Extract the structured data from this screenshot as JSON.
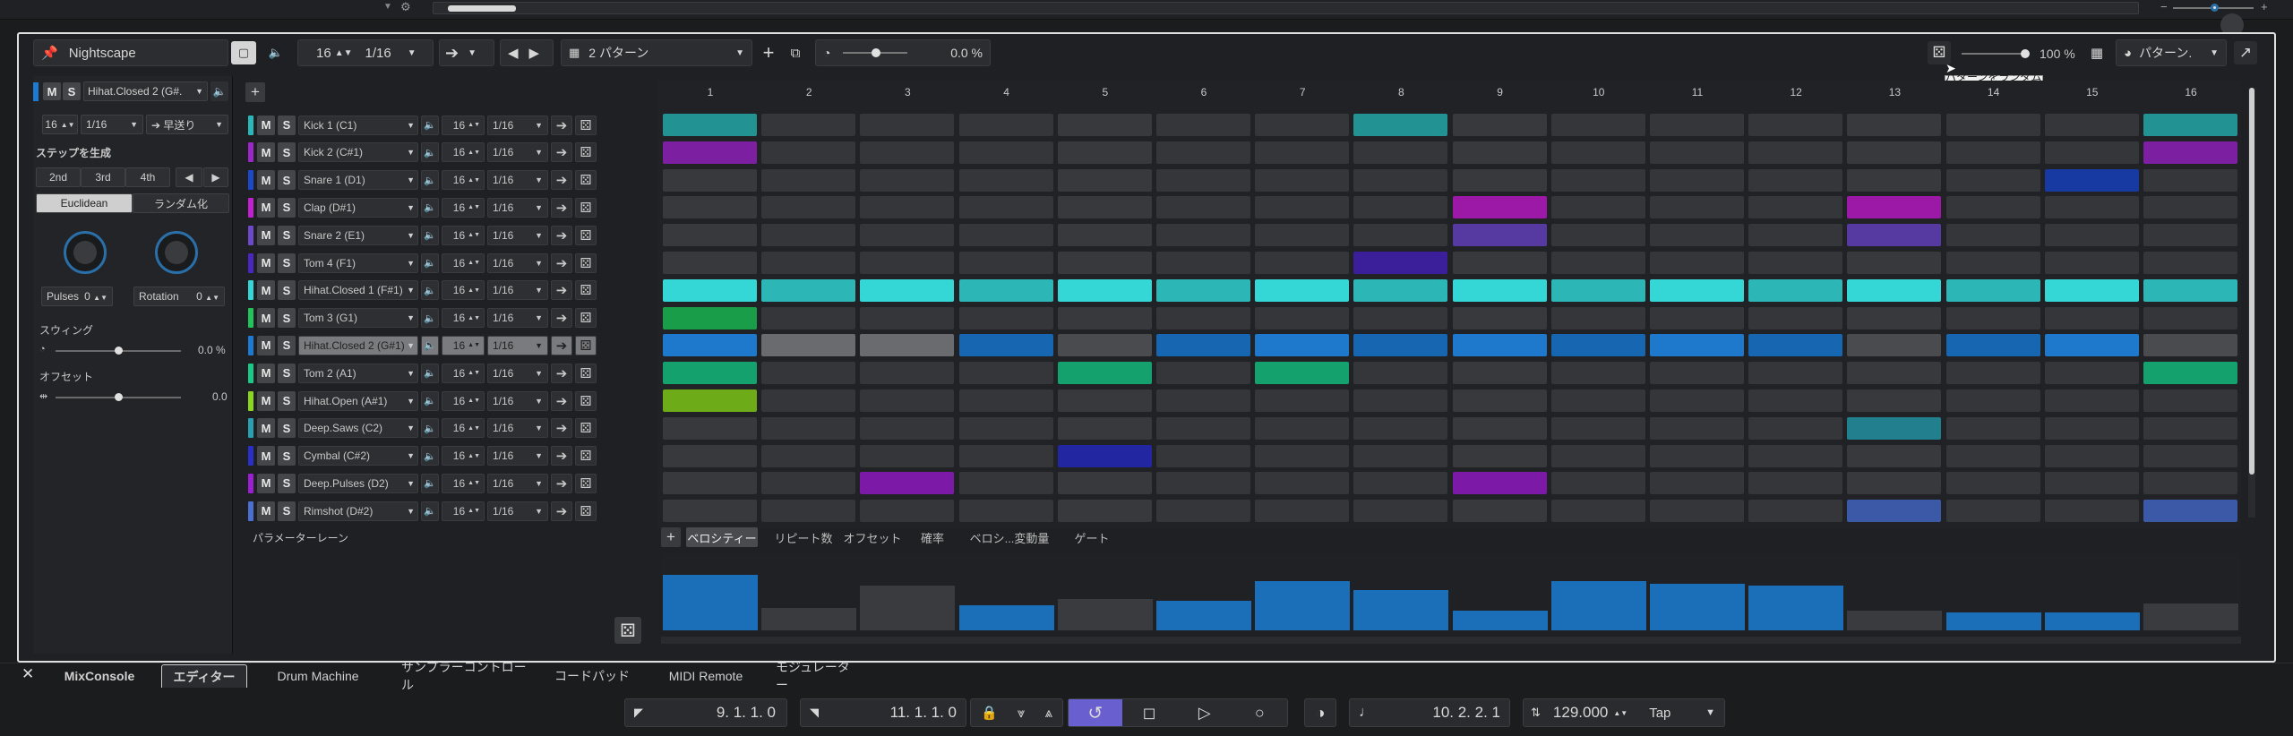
{
  "toolbar": {
    "title": "Nightscape",
    "quantize": "16",
    "resolution": "1/16",
    "pattern_name": "2 パターン",
    "swing_value": "0.0 %",
    "random_amount": "100 %",
    "pattern_menu": "パターン.",
    "tooltip": "パターンをランダム化"
  },
  "left": {
    "m": "M",
    "s": "S",
    "track_select": "Hihat.Closed 2 (G#.",
    "steps": "16",
    "res": "1/16",
    "direction": "早送り",
    "generate_label": "ステップを生成",
    "gen_2nd": "2nd",
    "gen_3rd": "3rd",
    "gen_4th": "4th",
    "euclidean": "Euclidean",
    "randomize": "ランダム化",
    "pulses_label": "Pulses",
    "pulses_value": "0",
    "rotation_label": "Rotation",
    "rotation_value": "0",
    "swing_label": "スウィング",
    "swing_value": "0.0 %",
    "offset_label": "オフセット",
    "offset_value": "0.0"
  },
  "tracks": [
    {
      "name": "Kick 1 (C1)",
      "color": "#2ab7b7",
      "steps": "16",
      "res": "1/16"
    },
    {
      "name": "Kick 2 (C#1)",
      "color": "#9b27c9",
      "steps": "16",
      "res": "1/16"
    },
    {
      "name": "Snare 1 (D1)",
      "color": "#1c49c9",
      "steps": "16",
      "res": "1/16"
    },
    {
      "name": "Clap (D#1)",
      "color": "#c21fcf",
      "steps": "16",
      "res": "1/16"
    },
    {
      "name": "Snare 2 (E1)",
      "color": "#6d49c9",
      "steps": "16",
      "res": "1/16"
    },
    {
      "name": "Tom 4 (F1)",
      "color": "#4a27c0",
      "steps": "16",
      "res": "1/16"
    },
    {
      "name": "Hihat.Closed 1 (F#1)",
      "color": "#35d6d6",
      "steps": "16",
      "res": "1/16"
    },
    {
      "name": "Tom 3 (G1)",
      "color": "#21c45a",
      "steps": "16",
      "res": "1/16"
    },
    {
      "name": "Hihat.Closed 2 (G#1)",
      "color": "#1e7ad0",
      "steps": "16",
      "res": "1/16"
    },
    {
      "name": "Tom 2 (A1)",
      "color": "#19c988",
      "steps": "16",
      "res": "1/16"
    },
    {
      "name": "Hihat.Open (A#1)",
      "color": "#8ad61f",
      "steps": "16",
      "res": "1/16"
    },
    {
      "name": "Deep.Saws (C2)",
      "color": "#2a9fb2",
      "steps": "16",
      "res": "1/16"
    },
    {
      "name": "Cymbal (C#2)",
      "color": "#2a2fc9",
      "steps": "16",
      "res": "1/16"
    },
    {
      "name": "Deep.Pulses (D2)",
      "color": "#9b1fd0",
      "steps": "16",
      "res": "1/16"
    },
    {
      "name": "Rimshot (D#2)",
      "color": "#4a6fd0",
      "steps": "16",
      "res": "1/16"
    }
  ],
  "columns": [
    "1",
    "2",
    "3",
    "4",
    "5",
    "6",
    "7",
    "8",
    "9",
    "10",
    "11",
    "12",
    "13",
    "14",
    "15",
    "16"
  ],
  "grid_on": [
    [
      1,
      0,
      0,
      0,
      0,
      0,
      0,
      1,
      0,
      0,
      0,
      0,
      0,
      0,
      0,
      1
    ],
    [
      1,
      0,
      0,
      0,
      0,
      0,
      0,
      0,
      0,
      0,
      0,
      0,
      0,
      0,
      0,
      1
    ],
    [
      0,
      0,
      0,
      0,
      0,
      0,
      0,
      0,
      0,
      0,
      0,
      0,
      0,
      0,
      1,
      0
    ],
    [
      0,
      0,
      0,
      0,
      0,
      0,
      0,
      0,
      1,
      0,
      0,
      0,
      1,
      0,
      0,
      0
    ],
    [
      0,
      0,
      0,
      0,
      0,
      0,
      0,
      0,
      1,
      0,
      0,
      0,
      1,
      0,
      0,
      0
    ],
    [
      0,
      0,
      0,
      0,
      0,
      0,
      0,
      1,
      0,
      0,
      0,
      0,
      0,
      0,
      0,
      0
    ],
    [
      1,
      1,
      1,
      1,
      1,
      1,
      1,
      1,
      1,
      1,
      1,
      1,
      1,
      1,
      1,
      1
    ],
    [
      1,
      0,
      0,
      0,
      0,
      0,
      0,
      0,
      0,
      0,
      0,
      0,
      0,
      0,
      0,
      0
    ],
    [
      1,
      2,
      2,
      1,
      3,
      1,
      1,
      1,
      1,
      1,
      1,
      1,
      3,
      1,
      1,
      3
    ],
    [
      1,
      0,
      0,
      0,
      1,
      0,
      1,
      0,
      0,
      0,
      0,
      0,
      0,
      0,
      0,
      1
    ],
    [
      1,
      0,
      0,
      0,
      0,
      0,
      0,
      0,
      0,
      0,
      0,
      0,
      0,
      0,
      0,
      0
    ],
    [
      0,
      0,
      0,
      0,
      0,
      0,
      0,
      0,
      0,
      0,
      0,
      0,
      1,
      0,
      0,
      0
    ],
    [
      0,
      0,
      0,
      0,
      1,
      0,
      0,
      0,
      0,
      0,
      0,
      0,
      0,
      0,
      0,
      0
    ],
    [
      0,
      0,
      1,
      0,
      0,
      0,
      0,
      0,
      1,
      0,
      0,
      0,
      0,
      0,
      0,
      0
    ],
    [
      0,
      0,
      0,
      0,
      0,
      0,
      0,
      0,
      0,
      0,
      0,
      0,
      1,
      0,
      0,
      1
    ]
  ],
  "lanes": {
    "param_lane_label": "パラメーターレーン",
    "tabs": [
      "ベロシティー",
      "リピート数",
      "オフセット",
      "確率",
      "ベロシ...変動量",
      "ゲート"
    ],
    "velocity": [
      0.62,
      0.25,
      0.5,
      0.28,
      0.35,
      0.33,
      0.55,
      0.45,
      0.22,
      0.55,
      0.52,
      0.5,
      0.22,
      0.2,
      0.2,
      0.3
    ],
    "velocity_on": [
      1,
      0,
      0,
      1,
      0,
      1,
      1,
      1,
      1,
      1,
      1,
      1,
      0,
      1,
      1,
      0
    ]
  },
  "bottom_tabs": [
    "MixConsole",
    "エディター",
    "Drum Machine",
    "サンプラーコントロール",
    "コードパッド",
    "MIDI Remote",
    "モジュレーター"
  ],
  "transport": {
    "left_locator": "9. 1. 1.   0",
    "right_locator": "11. 1. 1.   0",
    "position": "10. 2. 2.   1",
    "tempo": "129.000",
    "tap": "Tap"
  }
}
